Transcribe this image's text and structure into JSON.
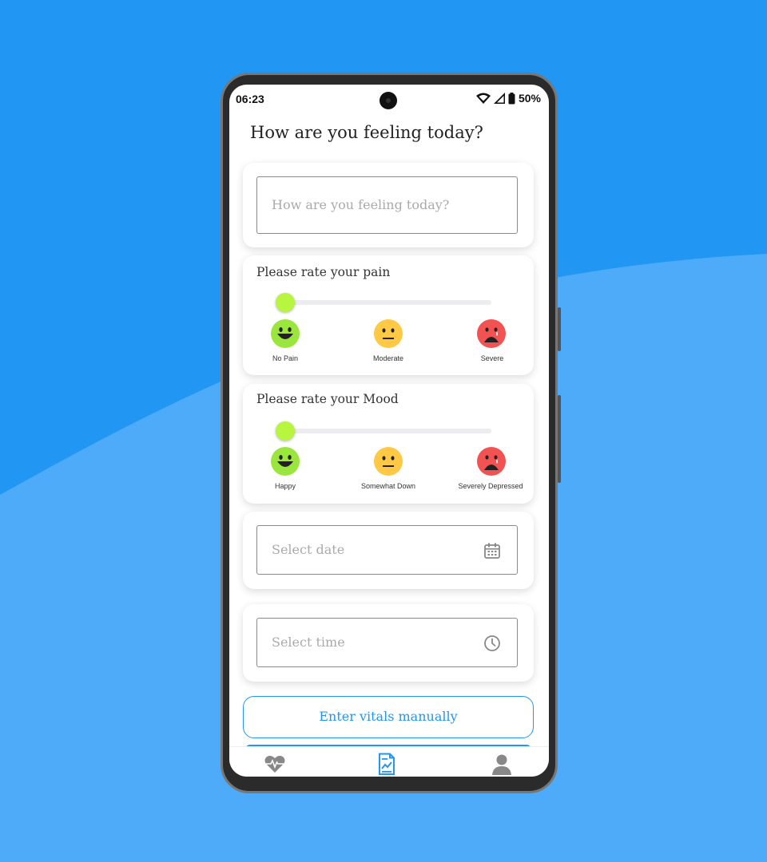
{
  "status_bar": {
    "time": "06:23",
    "battery": "50%"
  },
  "page": {
    "title": "How are you feeling today?"
  },
  "feeling_input": {
    "placeholder": "How are you feeling today?"
  },
  "pain": {
    "title": "Please rate your pain",
    "value": 0,
    "labels": [
      "No Pain",
      "Moderate",
      "Severe"
    ]
  },
  "mood": {
    "title": "Please rate your Mood",
    "value": 0,
    "labels": [
      "Happy",
      "Somewhat Down",
      "Severely Depressed"
    ]
  },
  "date_field": {
    "placeholder": "Select date",
    "icon": "calendar-icon"
  },
  "time_field": {
    "placeholder": "Select time",
    "icon": "clock-icon"
  },
  "actions": {
    "enter_vitals": "Enter vitals manually"
  },
  "nav": {
    "items": [
      "heart-pulse-icon",
      "report-chart-icon",
      "person-icon"
    ],
    "active": 1
  },
  "colors": {
    "brand": "#2196F3",
    "slider_thumb": "#b8f53f",
    "happy": "#9be63c",
    "neutral": "#ffc845",
    "sad": "#f25252"
  }
}
